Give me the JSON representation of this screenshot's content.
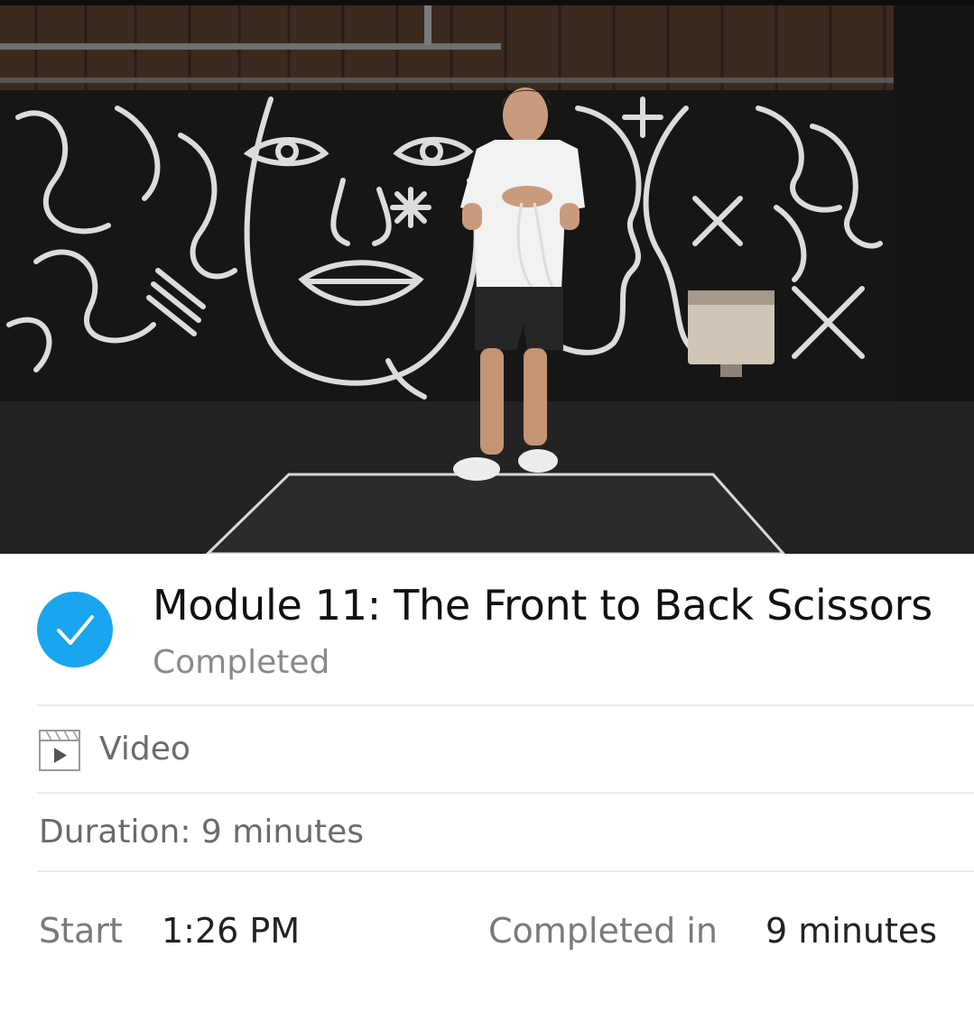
{
  "video": {
    "thumbnail_description": "instructor with jump rope in black mural studio",
    "play_state": "thumbnail"
  },
  "module": {
    "title": "Module 11: The Front to Back Scissors",
    "status": "Completed",
    "status_icon": "check-circle-icon",
    "accent_color": "#1aa5ef"
  },
  "content_type": {
    "icon": "video-clapper-icon",
    "label": "Video"
  },
  "duration": {
    "label": "Duration: 9 minutes"
  },
  "session": {
    "start_label": "Start",
    "start_value": "1:26 PM",
    "completed_label": "Completed in",
    "completed_value": "9 minutes"
  }
}
